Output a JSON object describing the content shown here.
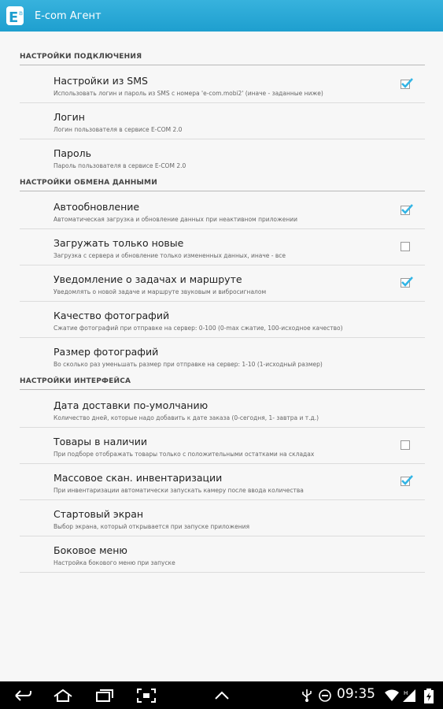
{
  "app": {
    "title": "E-com Агент",
    "icon": "ecom-logo-icon"
  },
  "sections": [
    {
      "title": "НАСТРОЙКИ ПОДКЛЮЧЕНИЯ",
      "items": [
        {
          "title": "Настройки из SMS",
          "summary": "Использовать логин и пароль из SMS с номера 'e-com.mobi2' (иначе - заданные ниже)",
          "checkbox": true,
          "checked": true
        },
        {
          "title": "Логин",
          "summary": "Логин пользователя в сервисе E-COM 2.0",
          "checkbox": false
        },
        {
          "title": "Пароль",
          "summary": "Пароль пользователя в сервисе E-COM 2.0",
          "checkbox": false
        }
      ]
    },
    {
      "title": "НАСТРОЙКИ ОБМЕНА ДАННЫМИ",
      "items": [
        {
          "title": "Автообновление",
          "summary": "Автоматическая загрузка и обновление данных при неактивном приложении",
          "checkbox": true,
          "checked": true
        },
        {
          "title": "Загружать только новые",
          "summary": "Загрузка с сервера и обновление только измененных данных, иначе - все",
          "checkbox": true,
          "checked": false
        },
        {
          "title": "Уведомление о задачах и маршруте",
          "summary": "Уведомлять о новой задаче и маршруте звуковым и вибросигналом",
          "checkbox": true,
          "checked": true
        },
        {
          "title": "Качество фотографий",
          "summary": "Сжатие фотографий при отправке на сервер: 0-100 (0-max сжатие, 100-исходное качество)",
          "checkbox": false
        },
        {
          "title": "Размер фотографий",
          "summary": "Во сколько раз уменьшать размер при отправке на сервер: 1-10 (1-исходный размер)",
          "checkbox": false
        }
      ]
    },
    {
      "title": "НАСТРОЙКИ ИНТЕРФЕЙСА",
      "items": [
        {
          "title": "Дата доставки по-умолчанию",
          "summary": "Количество дней, которые надо добавить к дате заказа (0-сегодня, 1- завтра и т.д.)",
          "checkbox": false
        },
        {
          "title": "Товары в наличии",
          "summary": "При подборе отображать товары только с положительными остатками на складах",
          "checkbox": true,
          "checked": false
        },
        {
          "title": "Массовое скан. инвентаризации",
          "summary": "При инвентаризации автоматически запускать камеру после ввода количества",
          "checkbox": true,
          "checked": true
        },
        {
          "title": "Стартовый экран",
          "summary": "Выбор экрана, который открывается при запуске приложения",
          "checkbox": false
        },
        {
          "title": "Боковое меню",
          "summary": "Настройка бокового меню при запуске",
          "checkbox": false
        }
      ]
    }
  ],
  "status_bar": {
    "time": "09:35",
    "icons": [
      "back-icon",
      "home-icon",
      "recent-apps-icon",
      "screenshot-icon",
      "menu-up-icon",
      "usb-icon",
      "do-not-disturb-icon",
      "wifi-icon",
      "signal-icon",
      "battery-icon"
    ]
  },
  "colors": {
    "accent": "#33b5e5",
    "actionbar": "#2aa8d8",
    "check": "#33b5e5"
  }
}
